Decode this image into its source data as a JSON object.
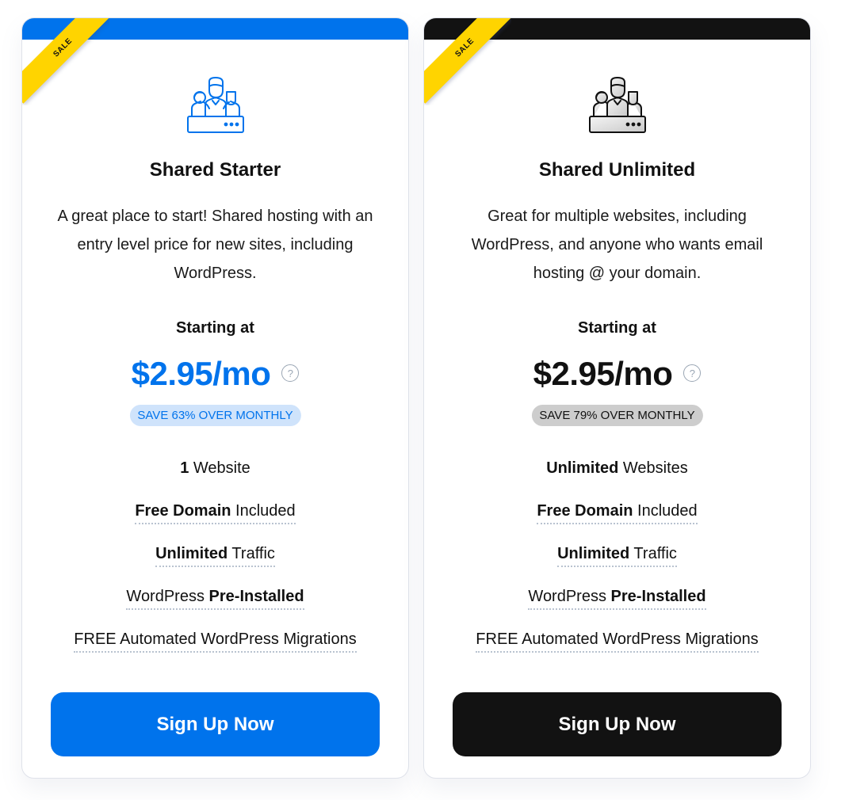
{
  "plans": [
    {
      "id": "shared-starter",
      "badge": "SALE",
      "icon": "team-server-icon",
      "accent_color": "#0073ec",
      "title": "Shared Starter",
      "description": "A great place to start! Shared hosting with an entry level price for new sites, including WordPress.",
      "starting_label": "Starting at",
      "price": "$2.95/mo",
      "help_icon": "question-circle-icon",
      "help_glyph": "?",
      "save_text": "SAVE 63% OVER MONTHLY",
      "features": [
        {
          "bold": "1",
          "text": " Website",
          "bold_first": true,
          "dotted": false
        },
        {
          "bold": "Free Domain",
          "text": " Included",
          "bold_first": true,
          "dotted": true
        },
        {
          "bold": "Unlimited",
          "text": " Traffic",
          "bold_first": true,
          "dotted": true
        },
        {
          "bold": "Pre-Installed",
          "text": "WordPress ",
          "bold_first": false,
          "dotted": true
        },
        {
          "bold": "",
          "text": "FREE Automated WordPress Migrations",
          "bold_first": false,
          "dotted": true
        }
      ],
      "cta_label": "Sign Up Now"
    },
    {
      "id": "shared-unlimited",
      "badge": "SALE",
      "icon": "team-server-icon",
      "accent_color": "#121212",
      "title": "Shared Unlimited",
      "description": "Great for multiple websites, including WordPress, and anyone who wants email hosting @ your domain.",
      "starting_label": "Starting at",
      "price": "$2.95/mo",
      "help_icon": "question-circle-icon",
      "help_glyph": "?",
      "save_text": "SAVE 79% OVER MONTHLY",
      "features": [
        {
          "bold": "Unlimited",
          "text": " Websites",
          "bold_first": true,
          "dotted": false
        },
        {
          "bold": "Free Domain",
          "text": " Included",
          "bold_first": true,
          "dotted": true
        },
        {
          "bold": "Unlimited",
          "text": " Traffic",
          "bold_first": true,
          "dotted": true
        },
        {
          "bold": "Pre-Installed",
          "text": "WordPress ",
          "bold_first": false,
          "dotted": true
        },
        {
          "bold": "",
          "text": "FREE Automated WordPress Migrations",
          "bold_first": false,
          "dotted": true
        }
      ],
      "cta_label": "Sign Up Now"
    }
  ]
}
